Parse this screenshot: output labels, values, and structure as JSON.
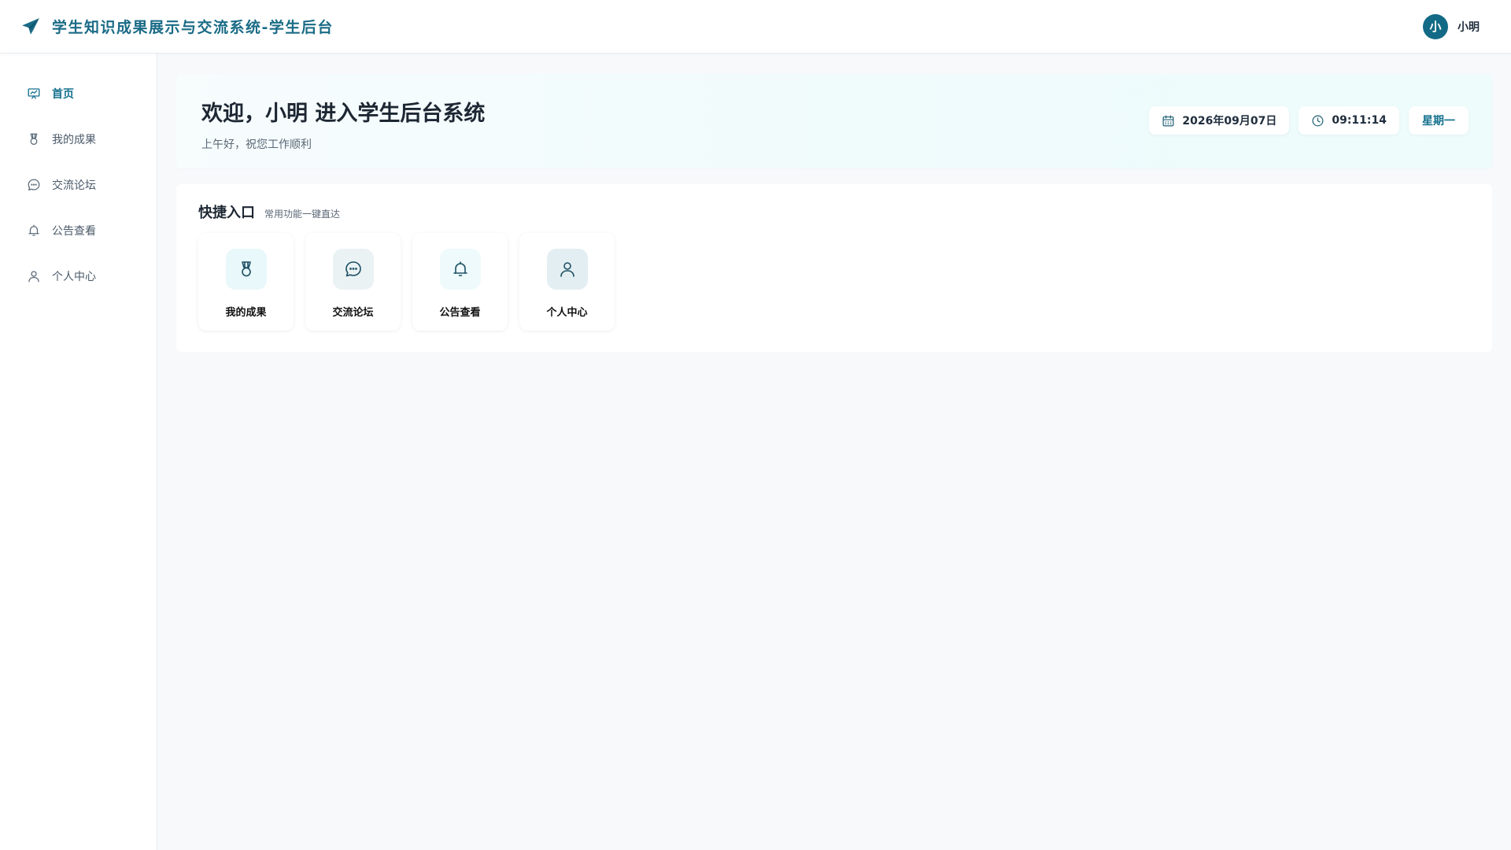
{
  "app": {
    "title": "学生知识成果展示与交流系统-学生后台",
    "brand_icon": "paper-plane-icon",
    "brand_color": "#1a6b86"
  },
  "user": {
    "avatar_text": "小",
    "name": "小明",
    "avatar_color": "#136a86"
  },
  "sidebar": {
    "items": [
      {
        "label": "首页",
        "icon": "home-chart-icon",
        "active": true
      },
      {
        "label": "我的成果",
        "icon": "medal-icon",
        "active": false
      },
      {
        "label": "交流论坛",
        "icon": "chat-bubble-icon",
        "active": false
      },
      {
        "label": "公告查看",
        "icon": "bell-icon",
        "active": false
      },
      {
        "label": "个人中心",
        "icon": "user-icon",
        "active": false
      }
    ]
  },
  "welcome": {
    "title": "欢迎，小明 进入学生后台系统",
    "subtitle": "上午好，祝您工作顺利",
    "date": "2026年09月07日",
    "time": "09:11:14",
    "weekday": "星期一"
  },
  "quick": {
    "title": "快捷入口",
    "subtitle": "常用功能一键直达",
    "cards": [
      {
        "label": "我的成果",
        "icon": "medal-icon",
        "bg": "#e9f8fa"
      },
      {
        "label": "交流论坛",
        "icon": "chat-bubble-icon",
        "bg": "#eaf2f4"
      },
      {
        "label": "公告查看",
        "icon": "bell-icon",
        "bg": "#eefafb"
      },
      {
        "label": "个人中心",
        "icon": "user-icon",
        "bg": "#e3eef2"
      }
    ]
  },
  "colors": {
    "accent": "#16728f",
    "page_bg": "#f7f9fb"
  }
}
